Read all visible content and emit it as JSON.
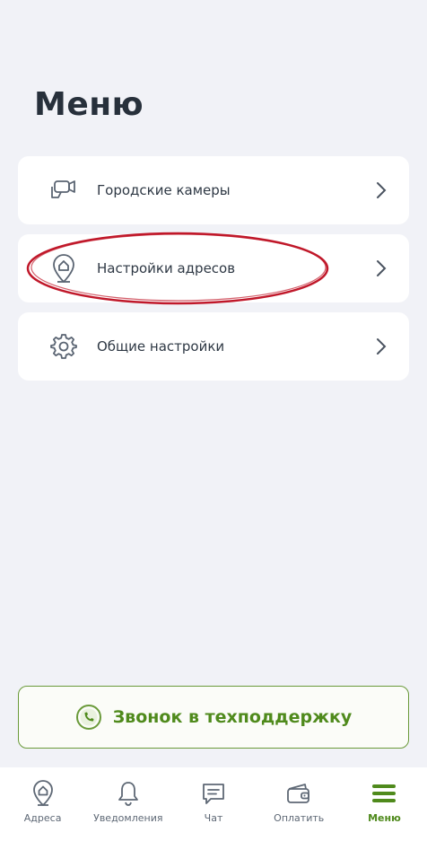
{
  "header": {
    "title": "Меню"
  },
  "menu": {
    "items": [
      {
        "label": "Городские камеры",
        "icon": "camera-icon"
      },
      {
        "label": "Настройки адресов",
        "icon": "location-pin-icon"
      },
      {
        "label": "Общие настройки",
        "icon": "gear-icon"
      }
    ]
  },
  "support": {
    "label": "Звонок в техподдержку",
    "icon": "phone-icon"
  },
  "nav": {
    "items": [
      {
        "label": "Адреса",
        "icon": "home-pin-icon",
        "active": false
      },
      {
        "label": "Уведомления",
        "icon": "bell-icon",
        "active": false
      },
      {
        "label": "Чат",
        "icon": "chat-icon",
        "active": false
      },
      {
        "label": "Оплатить",
        "icon": "wallet-icon",
        "active": false
      },
      {
        "label": "Меню",
        "icon": "hamburger-icon",
        "active": true
      }
    ]
  },
  "colors": {
    "accent": "#4f8a1c",
    "highlight": "#c0182a",
    "background": "#f1f2f7"
  }
}
